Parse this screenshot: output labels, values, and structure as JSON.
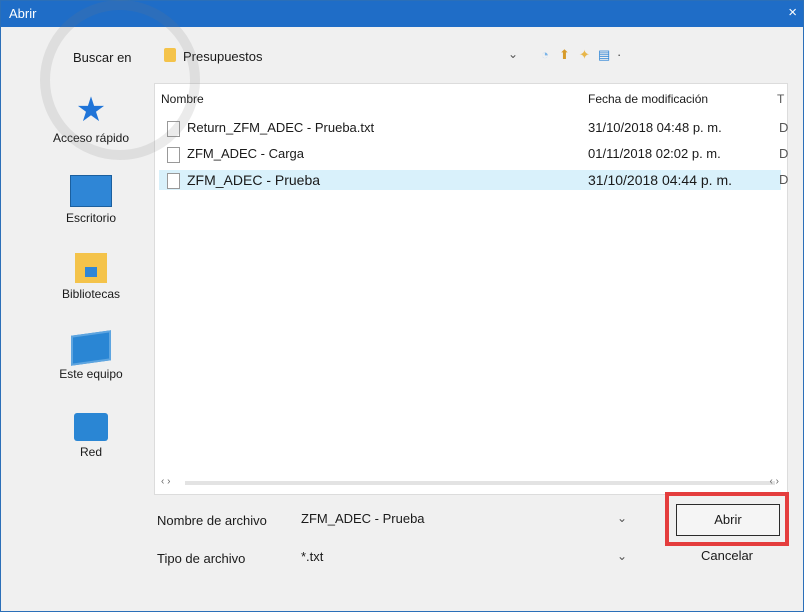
{
  "dialog": {
    "title": "Abrir",
    "close_glyph": "×"
  },
  "toolbar": {
    "look_in_label": "Buscar en",
    "look_in_value": "Presupuestos",
    "caret": "⌄",
    "icons": [
      "back-icon",
      "up-folder-icon",
      "new-folder-icon",
      "view-menu-icon"
    ]
  },
  "places": [
    {
      "label": "Acceso rápido",
      "icon": "star-icon"
    },
    {
      "label": "Escritorio",
      "icon": "desktop-icon"
    },
    {
      "label": "Bibliotecas",
      "icon": "libraries-icon"
    },
    {
      "label": "Este equipo",
      "icon": "computer-icon"
    },
    {
      "label": "Red",
      "icon": "network-icon"
    }
  ],
  "files": {
    "columns": {
      "name": "Nombre",
      "date": "Fecha de modificación",
      "extra": "T"
    },
    "rows": [
      {
        "name": "Return_ZFM_ADEC - Prueba.txt",
        "date": "31/10/2018 04:48 p. m.",
        "extra": "D"
      },
      {
        "name": "ZFM_ADEC - Carga",
        "date": "01/11/2018 02:02 p. m.",
        "extra": "D"
      },
      {
        "name": "ZFM_ADEC - Prueba",
        "date": "31/10/2018 04:44 p. m.",
        "extra": "D",
        "selected": true
      }
    ]
  },
  "filename": {
    "label": "Nombre de archivo",
    "value": "ZFM_ADEC - Prueba"
  },
  "filetype": {
    "label": "Tipo de archivo",
    "value": "*.txt"
  },
  "buttons": {
    "open": "Abrir",
    "cancel": "Cancelar"
  },
  "colors": {
    "titlebar": "#1f6dc7",
    "selection": "#d9f1fb",
    "highlight": "#e43d3d"
  }
}
